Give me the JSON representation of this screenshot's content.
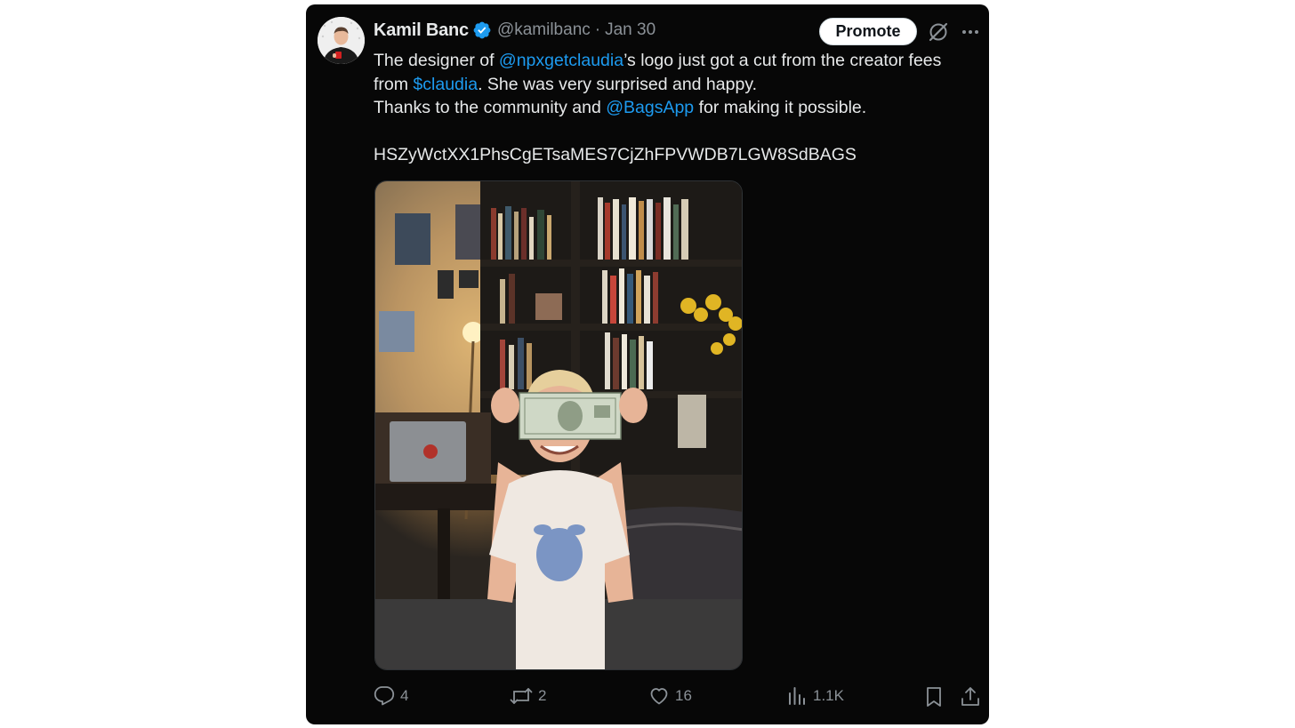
{
  "tweet": {
    "author": {
      "name": "Kamil Banc",
      "handle": "@kamilbanc",
      "separator": "·",
      "date": "Jan 30",
      "verified": true
    },
    "promote_label": "Promote",
    "text": {
      "l1_a": "The designer of ",
      "l1_link": "@npxgetclaudia",
      "l1_b": "’s logo just got a cut from the creator fees",
      "l2_a": "from ",
      "l2_link": "$claudia",
      "l2_b": ". She was very surprised and happy.",
      "l3_a": "Thanks to the community and ",
      "l3_link": "@BagsApp",
      "l3_b": " for making it possible.",
      "l4": "HSZyWctXX1PhsCgETsaMES7CjZhFPVWDB7LGW8SdBAGS"
    },
    "metrics": {
      "replies": "4",
      "reposts": "2",
      "likes": "16",
      "views": "1.1K"
    }
  },
  "colors": {
    "background": "#070707",
    "text": "#e7e9ea",
    "muted": "#8b9197",
    "link": "#1d9bf0",
    "verified": "#1d9bf0"
  },
  "icons": [
    "verified-badge-icon",
    "grok-icon",
    "more-icon",
    "reply-icon",
    "repost-icon",
    "like-icon",
    "views-icon",
    "bookmark-icon",
    "share-icon"
  ]
}
